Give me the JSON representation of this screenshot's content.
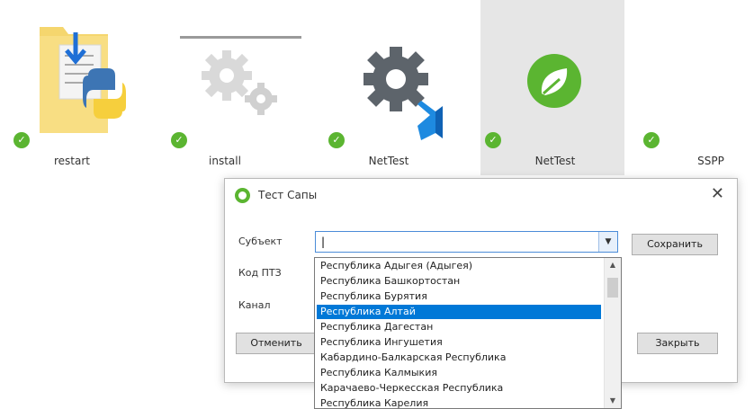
{
  "desktop": {
    "icons": [
      {
        "label": "restart",
        "status": "ok"
      },
      {
        "label": "install",
        "status": "ok"
      },
      {
        "label": "NetTest",
        "status": "ok"
      },
      {
        "label": "NetTest",
        "status": "ok",
        "selected": true
      },
      {
        "label": "SSPP",
        "status": "ok"
      }
    ]
  },
  "dialog": {
    "title": "Тест Сапы",
    "labels": {
      "subject": "Субъект",
      "ptz_code": "Код ПТЗ",
      "channel": "Канал"
    },
    "subject_value": "|",
    "buttons": {
      "save": "Сохранить",
      "cancel": "Отменить",
      "close": "Закрыть"
    },
    "close_glyph": "✕"
  },
  "dropdown": {
    "items": [
      "Республика Адыгея (Адыгея)",
      "Республика Башкортостан",
      "Республика Бурятия",
      "Республика Алтай",
      "Республика Дагестан",
      "Республика Ингушетия",
      "Кабардино-Балкарская Республика",
      "Республика Калмыкия",
      "Карачаево-Черкесская Республика",
      "Республика Карелия"
    ],
    "highlighted_index": 3
  },
  "colors": {
    "accent": "#0078d7",
    "status_ok": "#5bb531"
  }
}
